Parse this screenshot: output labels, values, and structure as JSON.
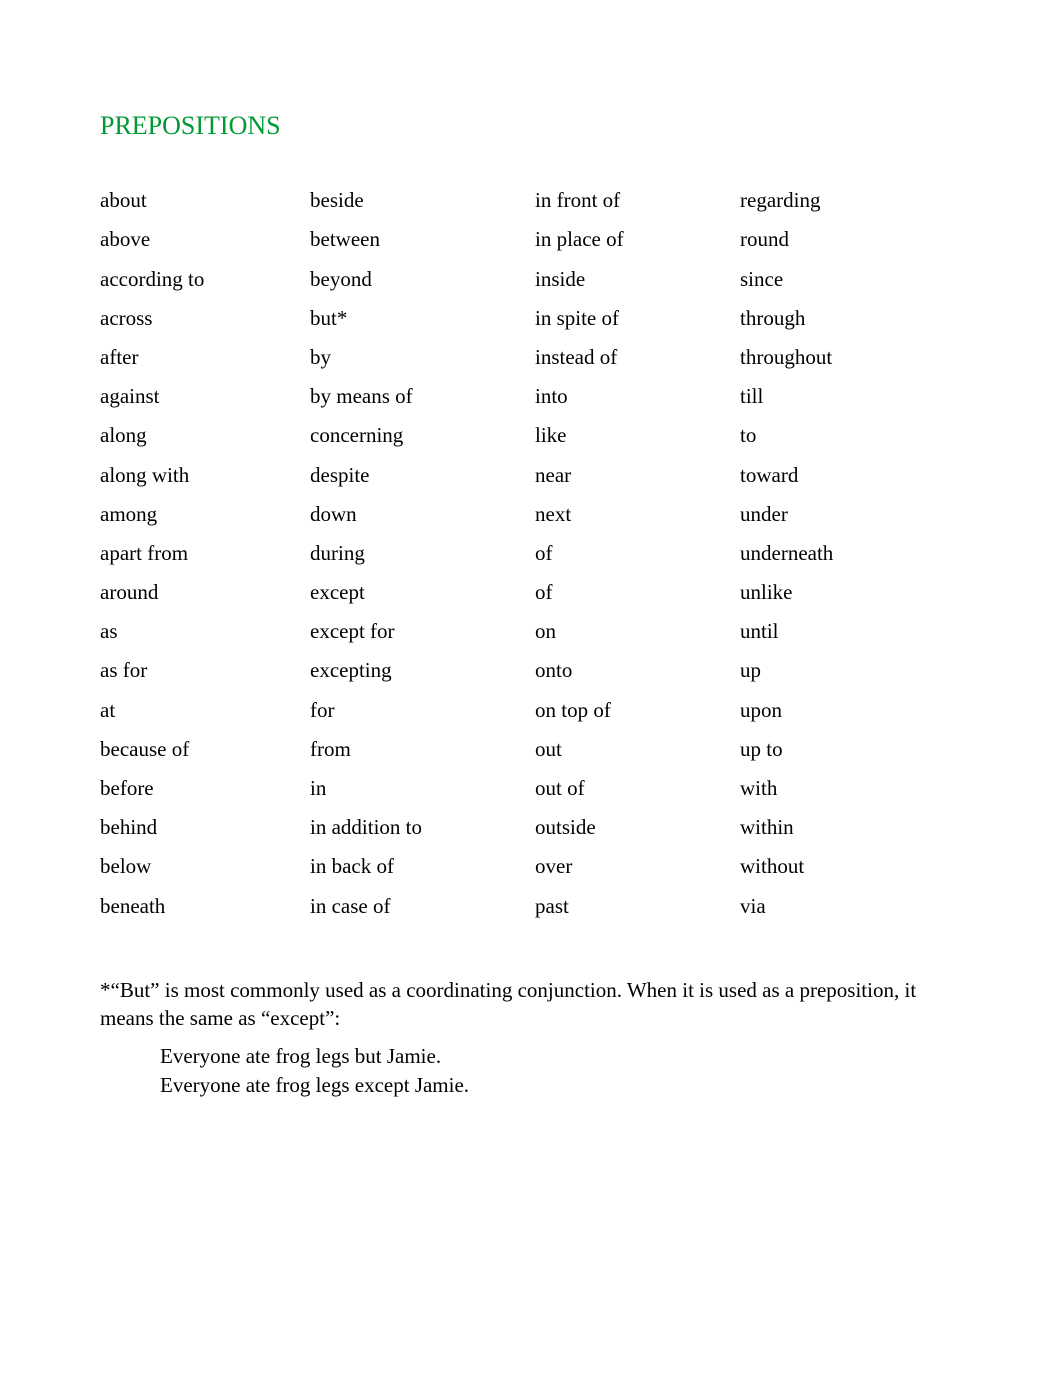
{
  "title": "PREPOSITIONS",
  "columns": {
    "c1": [
      "about",
      "above",
      "according to",
      "across",
      "after",
      "against",
      "along",
      "along with",
      "among",
      "apart from",
      "around",
      "as",
      "as for",
      "at",
      "because of",
      "before",
      "behind",
      "below",
      "beneath"
    ],
    "c2": [
      "beside",
      "between",
      "beyond",
      "but*",
      "by",
      "by means of",
      "concerning",
      "despite",
      "down",
      "during",
      "except",
      "except for",
      "excepting",
      "for",
      "from",
      "in",
      "in addition to",
      "in back of",
      "in case of"
    ],
    "c3": [
      "in front of",
      "in place of",
      "inside",
      "in spite of",
      "instead of",
      "into",
      "like",
      "near",
      "next",
      "of",
      "of",
      "on",
      "onto",
      "on top of",
      "out",
      "out of",
      "outside",
      "over",
      "past"
    ],
    "c4": [
      "regarding",
      "round",
      "since",
      "through",
      "throughout",
      "till",
      "to",
      "toward",
      "under",
      "underneath",
      "unlike",
      "until",
      "up",
      "upon",
      "up to",
      "with",
      "within",
      "without",
      "via"
    ]
  },
  "footnote": {
    "line1_a": "*“But” is most commonly used as a coordinating conjunction.   When it is used as a preposition, it",
    "line2_a": "means the same as “",
    "line2_b": "except",
    "line2_c": "”:"
  },
  "examples": {
    "ex1_a": "Everyone ate frog legs ",
    "ex1_b": "but",
    "ex1_c": " Jamie.",
    "ex2_a": "Everyone ate frog legs ",
    "ex2_b": "except",
    "ex2_c": " Jamie."
  }
}
